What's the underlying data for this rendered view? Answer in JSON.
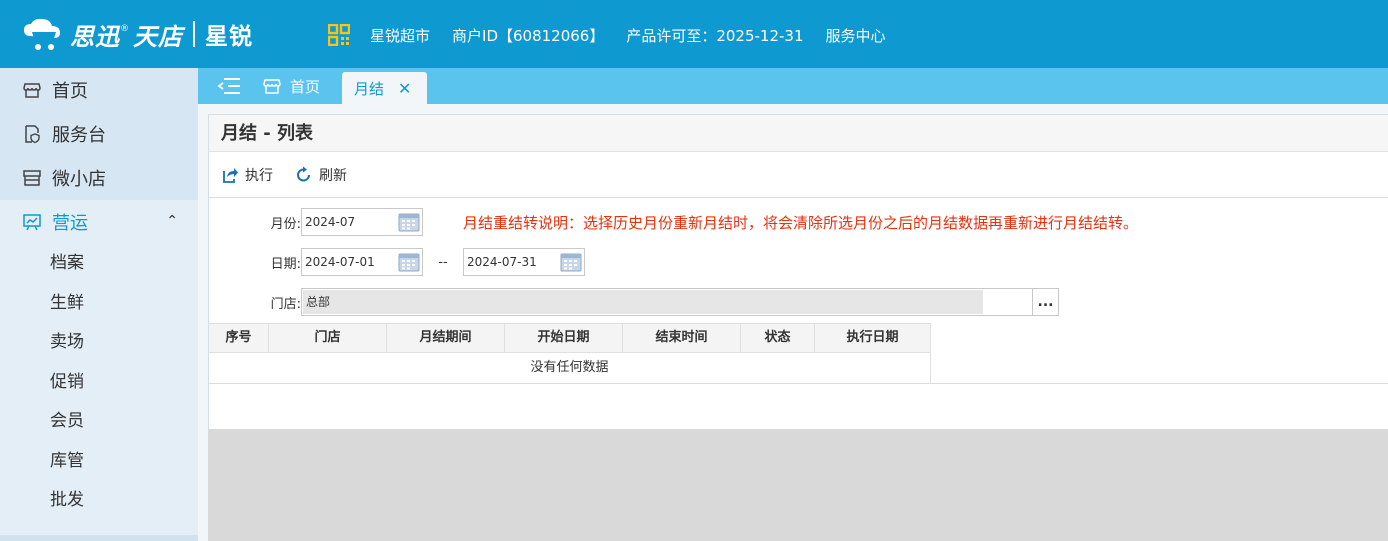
{
  "header": {
    "brand": "思迅",
    "brand_sub": "天店",
    "product": "星锐",
    "store_name": "星锐超市",
    "merchant_id": "商户ID【60812066】",
    "license": "产品许可至：2025-12-31",
    "service_center": "服务中心"
  },
  "sidebar": {
    "items": [
      {
        "label": "首页"
      },
      {
        "label": "服务台"
      },
      {
        "label": "微小店"
      },
      {
        "label": "营运"
      }
    ],
    "sub_items": [
      "档案",
      "生鲜",
      "卖场",
      "促销",
      "会员",
      "库管",
      "批发"
    ]
  },
  "tabs": {
    "home": "首页",
    "active": "月结",
    "close": "✕"
  },
  "page": {
    "title": "月结 - 列表",
    "toolbar": {
      "execute": "执行",
      "refresh": "刷新"
    },
    "form": {
      "month_label": "月份:",
      "month_value": "2024-07",
      "notice": "月结重结转说明：选择历史月份重新月结时，将会清除所选月份之后的月结数据再重新进行月结结转。",
      "date_label": "日期:",
      "date_from": "2024-07-01",
      "date_sep": "--",
      "date_to": "2024-07-31",
      "store_label": "门店:",
      "store_value": "总部",
      "more": "..."
    },
    "grid": {
      "columns": [
        "序号",
        "门店",
        "月结期间",
        "开始日期",
        "结束时间",
        "状态",
        "执行日期"
      ],
      "empty_text": "没有任何数据"
    }
  },
  "colors": {
    "header_bg": "#0f99d1",
    "tabbar_bg": "#5ac4ee",
    "notice": "#e8320f",
    "accent": "#0f99d1"
  }
}
